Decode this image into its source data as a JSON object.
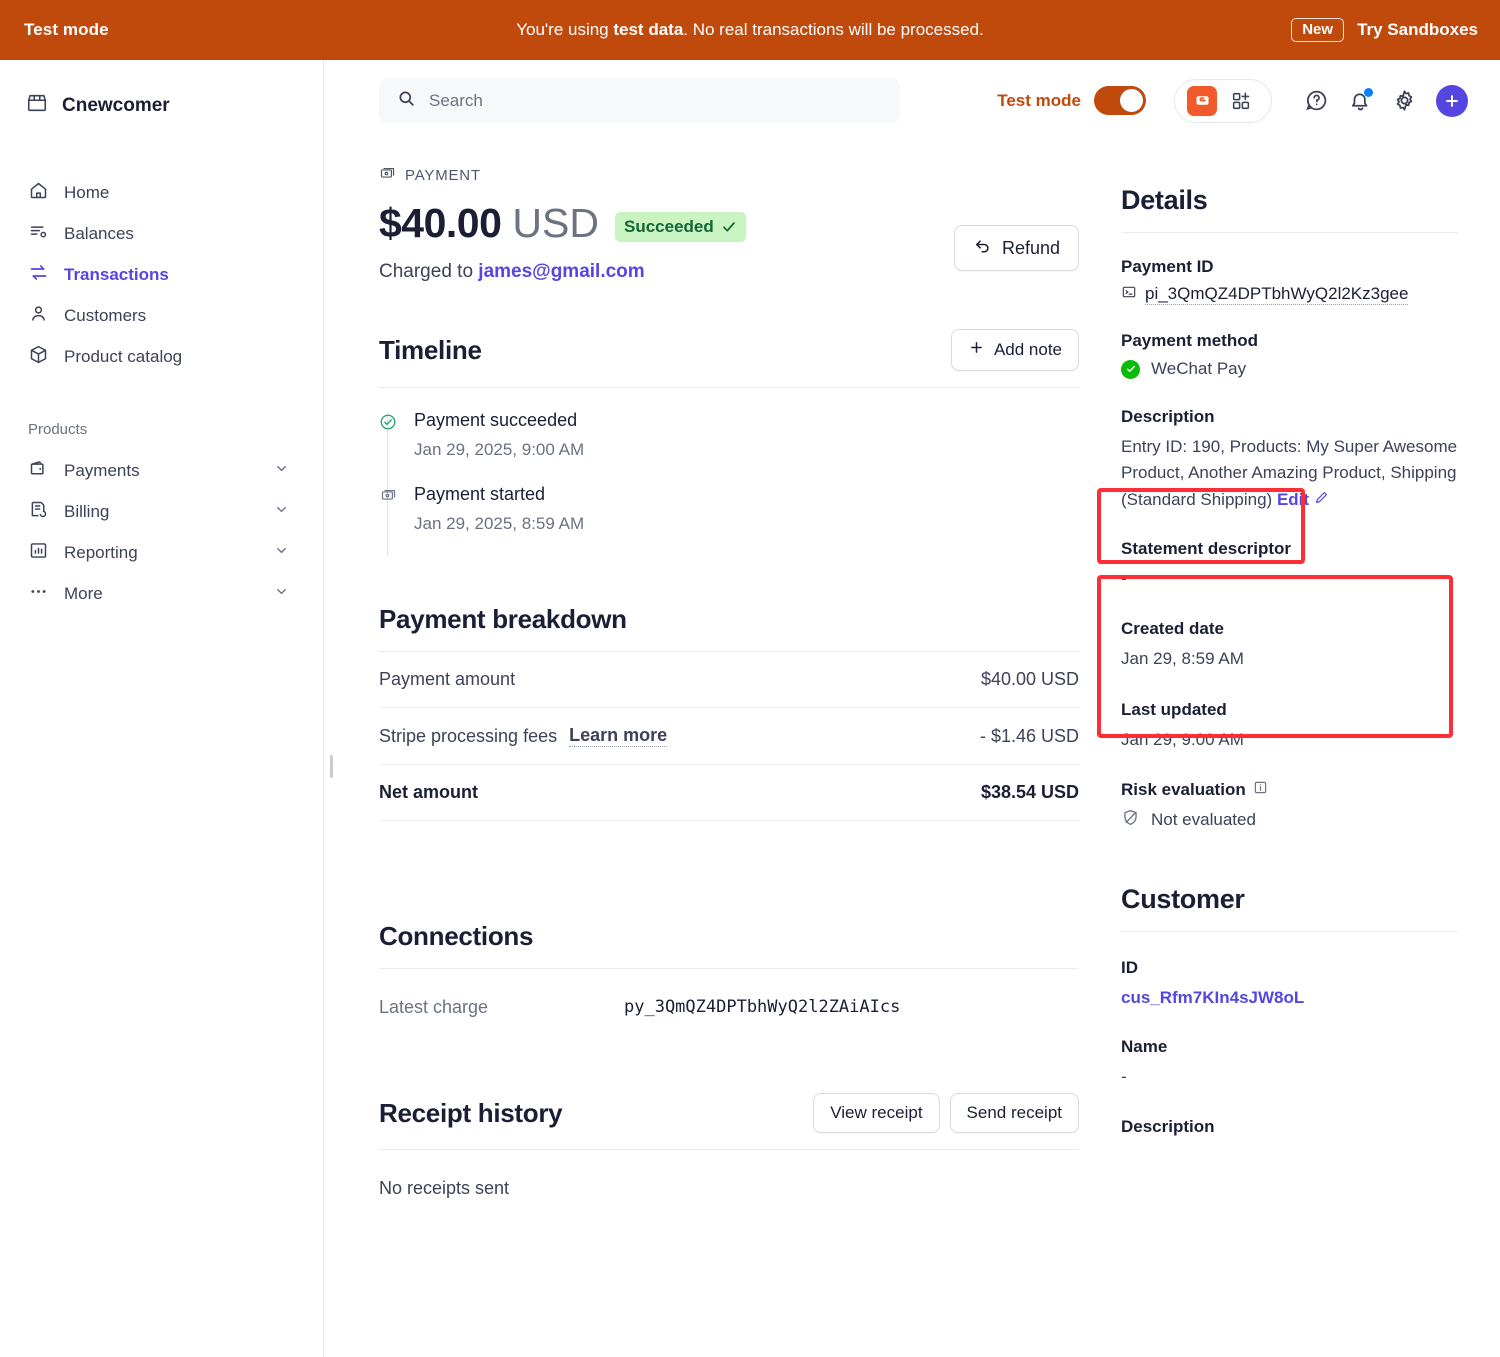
{
  "test_banner": {
    "left_label": "Test mode",
    "message_prefix": "You're using ",
    "message_bold": "test data",
    "message_suffix": ". No real transactions will be processed.",
    "new_pill": "New",
    "cta": "Try Sandboxes",
    "bg_color": "#c0490c"
  },
  "sidebar": {
    "brand": "Cnewcomer",
    "items": [
      {
        "label": "Home",
        "icon": "home-icon",
        "active": false
      },
      {
        "label": "Balances",
        "icon": "balances-icon",
        "active": false
      },
      {
        "label": "Transactions",
        "icon": "transactions-icon",
        "active": true
      },
      {
        "label": "Customers",
        "icon": "customers-icon",
        "active": false
      },
      {
        "label": "Product catalog",
        "icon": "product-catalog-icon",
        "active": false
      }
    ],
    "section_title": "Products",
    "product_items": [
      {
        "label": "Payments",
        "icon": "wallet-icon"
      },
      {
        "label": "Billing",
        "icon": "billing-icon"
      },
      {
        "label": "Reporting",
        "icon": "reporting-icon"
      },
      {
        "label": "More",
        "icon": "more-icon"
      }
    ],
    "active_color": "#5546e1"
  },
  "topbar": {
    "search_placeholder": "Search",
    "test_mode_label": "Test mode",
    "test_mode_on": true,
    "icons": [
      "stripe-app-icon",
      "apps-grid-icon",
      "help-icon",
      "notifications-icon",
      "settings-icon",
      "create-icon"
    ]
  },
  "payment": {
    "eyebrow": "PAYMENT",
    "amount": "$40.00",
    "currency": "USD",
    "status": "Succeeded",
    "charged_to_prefix": "Charged to",
    "charged_to_email": "james@gmail.com",
    "refund_label": "Refund"
  },
  "timeline": {
    "heading": "Timeline",
    "add_note_label": "Add note",
    "events": [
      {
        "title": "Payment succeeded",
        "date": "Jan 29, 2025, 9:00 AM",
        "icon": "check-circle-icon"
      },
      {
        "title": "Payment started",
        "date": "Jan 29, 2025, 8:59 AM",
        "icon": "payment-icon"
      }
    ]
  },
  "breakdown": {
    "heading": "Payment breakdown",
    "rows": [
      {
        "label": "Payment amount",
        "link": "",
        "value": "$40.00 USD",
        "total": false
      },
      {
        "label": "Stripe processing fees",
        "link": "Learn more",
        "value": "- $1.46 USD",
        "total": false
      },
      {
        "label": "Net amount",
        "link": "",
        "value": "$38.54 USD",
        "total": true
      }
    ]
  },
  "connections": {
    "heading": "Connections",
    "label": "Latest charge",
    "value": "py_3QmQZ4DPTbhWyQ2l2ZAiAIcs"
  },
  "receipts": {
    "heading": "Receipt history",
    "view_label": "View receipt",
    "send_label": "Send receipt",
    "empty": "No receipts sent"
  },
  "details": {
    "heading": "Details",
    "payment_id_label": "Payment ID",
    "payment_id_value": "pi_3QmQZ4DPTbhWyQ2l2Kz3gee",
    "payment_method_label": "Payment method",
    "payment_method_value": "WeChat Pay",
    "description_label": "Description",
    "description_value": "Entry ID: 190, Products: My Super Awesome Product, Another Amazing Product, Shipping (Standard Shipping)",
    "description_edit": "Edit",
    "statement_descriptor_label": "Statement descriptor",
    "statement_descriptor_value": "-",
    "created_date_label": "Created date",
    "created_date_value": "Jan 29, 8:59 AM",
    "last_updated_label": "Last updated",
    "last_updated_value": "Jan 29, 9:00 AM",
    "risk_label": "Risk evaluation",
    "risk_value": "Not evaluated"
  },
  "customer": {
    "heading": "Customer",
    "id_label": "ID",
    "id_value": "cus_Rfm7KIn4sJW8oL",
    "name_label": "Name",
    "name_value": "-",
    "description_label": "Description"
  },
  "annotations": {
    "highlight_color": "#ff2d36",
    "highlighted_regions": [
      "payment-method-field",
      "description-field"
    ]
  }
}
